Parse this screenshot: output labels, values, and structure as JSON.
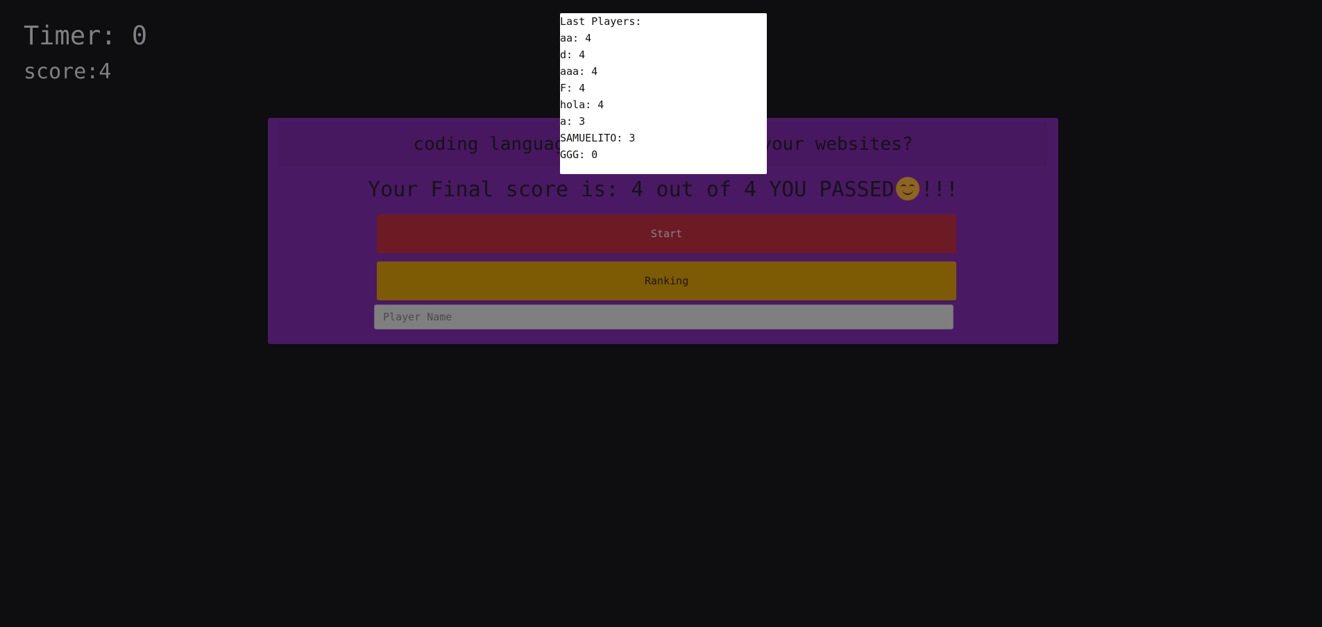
{
  "stats": {
    "timer": "Timer: 0",
    "score": "score:4"
  },
  "quiz": {
    "question": "coding languages do you use for your websites?",
    "final_score_text": "Your Final score is: 4 out of 4 YOU PASSED",
    "final_score_suffix": "!!!",
    "emoji": "smiling-face-icon",
    "start_label": "Start",
    "ranking_label": "Ranking",
    "player_name_placeholder": "Player Name",
    "player_name_value": ""
  },
  "last_players": {
    "title": "Last Players:",
    "entries": [
      "aa: 4",
      "d: 4",
      "aaa: 4",
      "F: 4",
      "hola: 4",
      "a: 3",
      "SAMUELITO: 3",
      "GGG: 0"
    ]
  },
  "colors": {
    "background": "#0e0d10",
    "card": "#4a1964",
    "start_button": "#6c1a24",
    "ranking_button": "#7d5a04"
  }
}
